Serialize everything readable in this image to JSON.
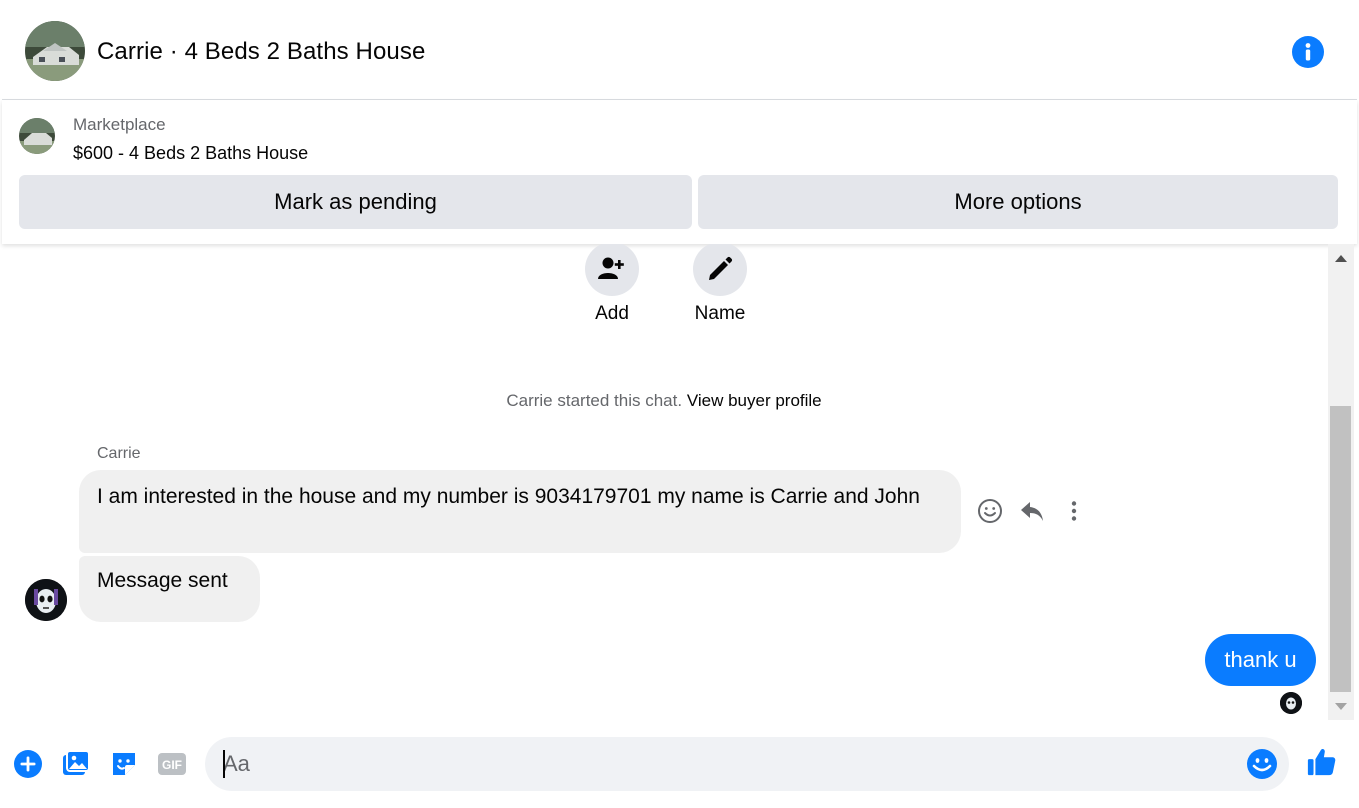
{
  "header": {
    "title": "Carrie · 4 Beds 2 Baths House",
    "avatar_icon": "house-photo",
    "info_icon": "info-icon"
  },
  "listing": {
    "source": "Marketplace",
    "title": "$600 - 4 Beds 2 Baths House",
    "mark_pending_label": "Mark as pending",
    "more_options_label": "More options"
  },
  "actions": {
    "add_label": "Add",
    "name_label": "Name"
  },
  "system": {
    "started_text": "Carrie started this chat.",
    "view_profile_link": "View buyer profile"
  },
  "messages": {
    "sender": "Carrie",
    "incoming_1": "I am interested in the house and my number is 9034179701 my name is Carrie and John",
    "incoming_2": "Message sent",
    "outgoing_1": "thank u"
  },
  "composer": {
    "placeholder": "Aa",
    "value": ""
  },
  "colors": {
    "accent": "#0a7cff",
    "bubble_incoming": "#f0f0f0",
    "button_grey": "#e4e6eb",
    "secondary_text": "#65676b"
  }
}
